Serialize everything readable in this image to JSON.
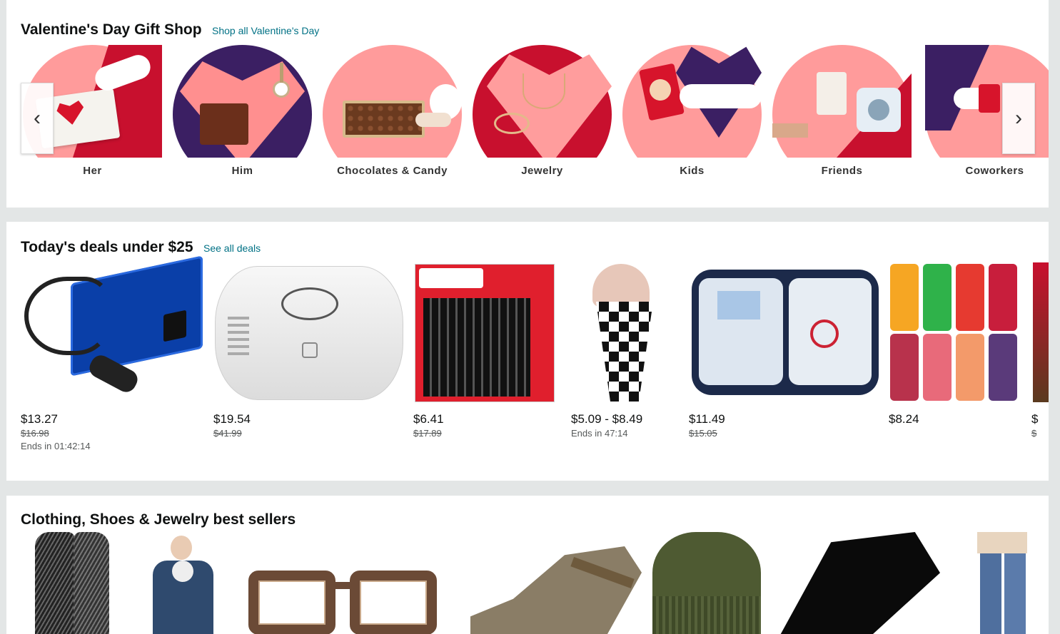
{
  "colors": {
    "link": "#007185",
    "pink": "#ff9b9b",
    "red": "#c8102e",
    "navy": "#3b1f63"
  },
  "valentine": {
    "title": "Valentine's Day Gift Shop",
    "link": "Shop all Valentine's Day",
    "categories": [
      {
        "label": "Her"
      },
      {
        "label": "Him"
      },
      {
        "label": "Chocolates & Candy"
      },
      {
        "label": "Jewelry"
      },
      {
        "label": "Kids"
      },
      {
        "label": "Friends"
      },
      {
        "label": "Coworkers"
      }
    ],
    "prev_icon": "‹",
    "next_icon": "›"
  },
  "deals": {
    "title": "Today's deals under $25",
    "link": "See all deals",
    "items": [
      {
        "price": "$13.27",
        "old": "$16.98",
        "ends": "Ends in 01:42:14",
        "product": "power-inverter"
      },
      {
        "price": "$19.54",
        "old": "$41.99",
        "product": "co-alarm"
      },
      {
        "price": "$6.41",
        "old": "$17.89",
        "product": "sharpie-markers"
      },
      {
        "price": "$5.09 - $8.49",
        "ends": "Ends in 47:14",
        "product": "scarf"
      },
      {
        "price": "$11.49",
        "old": "$15.05",
        "product": "first-aid-kit"
      },
      {
        "price": "$8.24",
        "product": "bubly-cans"
      },
      {
        "price": "$",
        "old": "$",
        "product": "partial-item"
      }
    ]
  },
  "best": {
    "title": "Clothing, Shoes & Jewelry best sellers"
  }
}
